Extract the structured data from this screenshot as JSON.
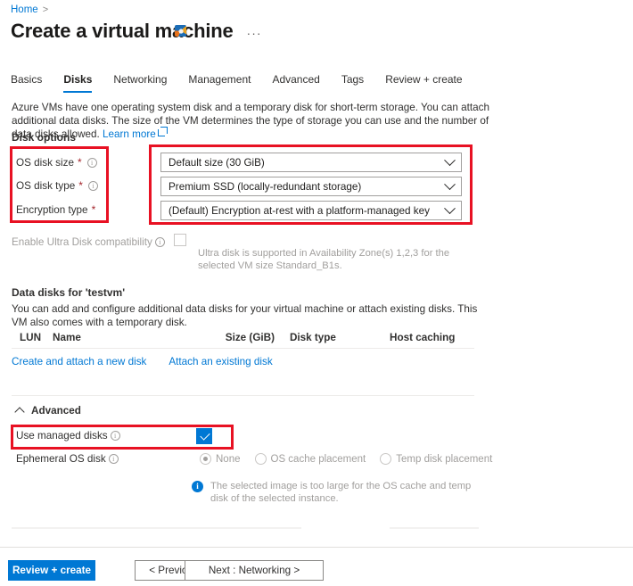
{
  "breadcrumb": {
    "home_label": "Home",
    "separator": ">"
  },
  "header": {
    "title": "Create a virtual machine",
    "ellipsis_label": "···",
    "browser_icon": "internet-explorer-icon"
  },
  "tabs": [
    {
      "label": "Basics",
      "active": false
    },
    {
      "label": "Disks",
      "active": true
    },
    {
      "label": "Networking",
      "active": false
    },
    {
      "label": "Management",
      "active": false
    },
    {
      "label": "Advanced",
      "active": false
    },
    {
      "label": "Tags",
      "active": false
    },
    {
      "label": "Review + create",
      "active": false
    }
  ],
  "description": {
    "line1": "Azure VMs have one operating system disk and a temporary disk for short-term storage. You can attach additional data disks.",
    "line2": "The size of the VM determines the type of storage you can use and the number of data disks allowed.",
    "learn_more": "Learn more"
  },
  "disk_options": {
    "heading": "Disk options",
    "fields": [
      {
        "label": "OS disk size",
        "required": true,
        "has_info": true,
        "value": "Default size (30 GiB)"
      },
      {
        "label": "OS disk type",
        "required": true,
        "has_info": true,
        "value": "Premium SSD (locally-redundant storage)"
      },
      {
        "label": "Encryption type",
        "required": true,
        "has_info": false,
        "value": "(Default) Encryption at-rest with a platform-managed key"
      }
    ],
    "ultra_disk": {
      "label": "Enable Ultra Disk compatibility",
      "checked": false,
      "note": "Ultra disk is supported in Availability Zone(s) 1,2,3 for the selected VM size Standard_B1s."
    }
  },
  "data_disks": {
    "heading": "Data disks for 'testvm'",
    "description": "You can add and configure additional data disks for your virtual machine or attach existing disks. This VM also comes with a temporary disk.",
    "columns": [
      "LUN",
      "Name",
      "Size (GiB)",
      "Disk type",
      "Host caching"
    ],
    "rows": [],
    "links": [
      "Create and attach a new disk",
      "Attach an existing disk"
    ]
  },
  "advanced": {
    "heading": "Advanced",
    "expanded": true,
    "use_managed_disks": {
      "label": "Use managed disks",
      "checked": true
    },
    "ephemeral_os_disk": {
      "label": "Ephemeral OS disk",
      "options": [
        {
          "label": "None",
          "selected": true
        },
        {
          "label": "OS cache placement",
          "selected": false
        },
        {
          "label": "Temp disk placement",
          "selected": false
        }
      ]
    },
    "info_message": "The selected image is too large for the OS cache and temp disk of the selected instance."
  },
  "footer": {
    "review_create": "Review + create",
    "previous": "< Previous",
    "next": "Next : Networking >"
  },
  "colors": {
    "accent_blue": "#0078d4",
    "annotation_red": "#e81123",
    "required_red": "#a4262c",
    "disabled_gray": "#a19f9d",
    "text": "#323130"
  }
}
